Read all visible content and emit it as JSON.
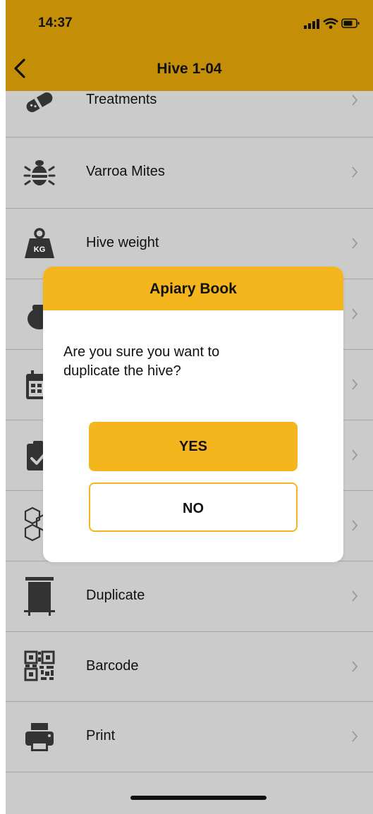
{
  "status_bar": {
    "time": "14:37"
  },
  "nav": {
    "title": "Hive 1-04",
    "back_icon": "chevron-left-icon"
  },
  "menu": {
    "items": [
      {
        "label": "Treatments",
        "icon": "treatments-icon"
      },
      {
        "label": "Varroa Mites",
        "icon": "varroa-mite-icon"
      },
      {
        "label": "Hive weight",
        "icon": "weight-kg-icon",
        "icon_text": "KG"
      },
      {
        "label": "",
        "icon": "honey-pot-icon"
      },
      {
        "label": "",
        "icon": "calendar-icon"
      },
      {
        "label": "",
        "icon": "clipboard-check-icon"
      },
      {
        "label": "",
        "icon": "honeycomb-icon"
      },
      {
        "label": "Duplicate",
        "icon": "hive-box-icon"
      },
      {
        "label": "Barcode",
        "icon": "qr-code-icon"
      },
      {
        "label": "Print",
        "icon": "printer-icon"
      }
    ]
  },
  "dialog": {
    "title": "Apiary Book",
    "message": "Are you sure you want to duplicate the hive?",
    "yes_label": "YES",
    "no_label": "NO"
  },
  "colors": {
    "header": "#c48f07",
    "accent": "#f4b61c",
    "background": "#cbcbcb"
  }
}
